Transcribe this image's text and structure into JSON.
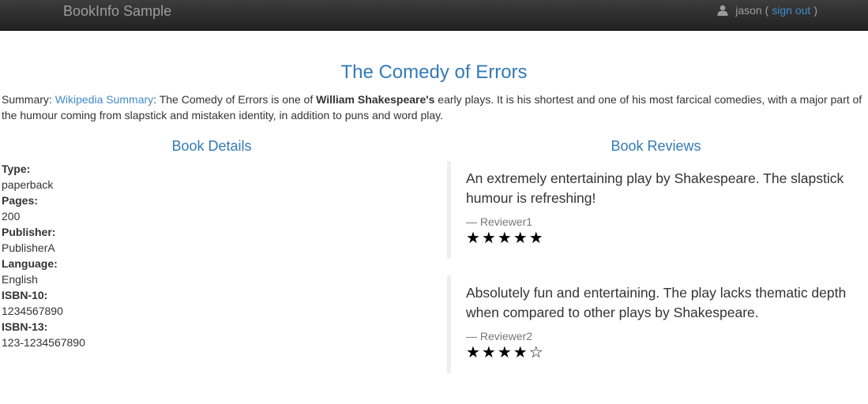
{
  "navbar": {
    "brand": "BookInfo Sample",
    "user": "jason",
    "open_paren": "(",
    "sign_out": "sign out",
    "close_paren": ")",
    "user_icon": "user-icon"
  },
  "book": {
    "title": "The Comedy of Errors",
    "summary_prefix": "Summary:",
    "summary_link": "Wikipedia Summary",
    "summary_text_1": ": The Comedy of Errors is one of",
    "summary_bold": "William Shakespeare's",
    "summary_text_2": "early plays. It is his shortest and one of his most farcical comedies, with a major part of the humour coming from slapstick and mistaken identity, in addition to puns and word play."
  },
  "details": {
    "heading": "Book Details",
    "items": [
      {
        "label": "Type:",
        "value": "paperback"
      },
      {
        "label": "Pages:",
        "value": "200"
      },
      {
        "label": "Publisher:",
        "value": "PublisherA"
      },
      {
        "label": "Language:",
        "value": "English"
      },
      {
        "label": "ISBN-10:",
        "value": "1234567890"
      },
      {
        "label": "ISBN-13:",
        "value": "123-1234567890"
      }
    ]
  },
  "reviews": {
    "heading": "Book Reviews",
    "items": [
      {
        "text": "An extremely entertaining play by Shakespeare. The slapstick humour is refreshing!",
        "reviewer": "— Reviewer1",
        "stars": "★★★★★",
        "rating": 5
      },
      {
        "text": "Absolutely fun and entertaining. The play lacks thematic depth when compared to other plays by Shakespeare.",
        "reviewer": "— Reviewer2",
        "stars": "★★★★☆",
        "rating": 4
      }
    ]
  }
}
